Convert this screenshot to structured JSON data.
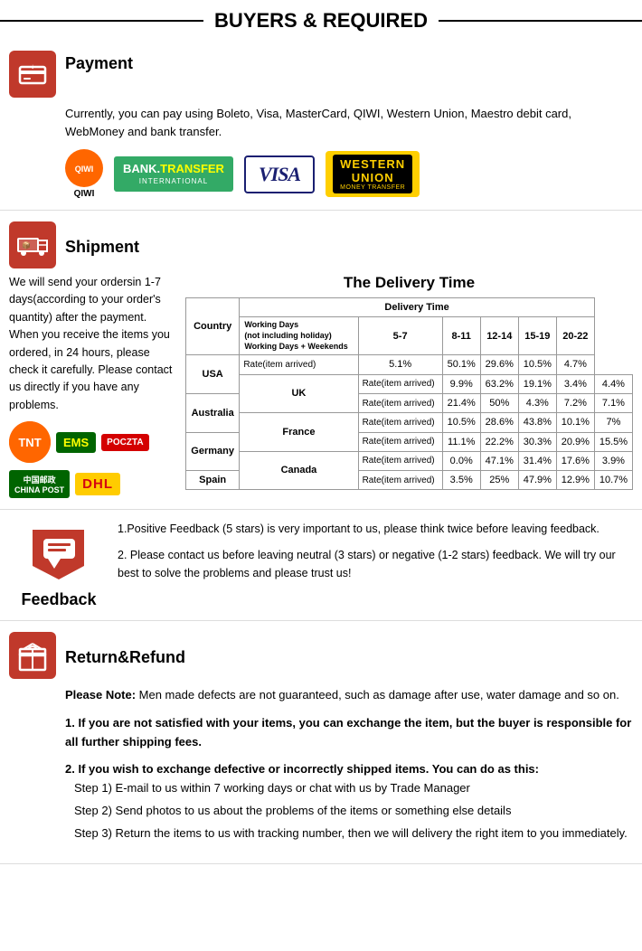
{
  "header": {
    "title": "BUYERS & REQUIRED"
  },
  "payment": {
    "section_title": "Payment",
    "description": "Currently, you can pay using Boleto, Visa, MasterCard, QIWI, Western Union, Maestro  debit card, WebMoney and bank transfer.",
    "logos": [
      {
        "name": "QIWI",
        "type": "qiwi"
      },
      {
        "name": "BANK TRANSFER INTERNATIONAL",
        "type": "bank_transfer"
      },
      {
        "name": "VISA",
        "type": "visa"
      },
      {
        "name": "WESTERN UNION MONEY TRANSFER",
        "type": "western_union"
      }
    ]
  },
  "shipment": {
    "section_title": "Shipment",
    "text": "We will send your ordersin 1-7 days(according to your order's quantity) after the payment. When you receive the items you ordered, in 24  hours, please check it carefully. Please  contact us directly if you have any problems.",
    "delivery_title": "The Delivery Time",
    "table": {
      "headers": [
        "Country",
        "Delivery Time"
      ],
      "wd_headers": [
        "Working Days\n(not including holiday)\nWorking Days + Weekends",
        "5-7",
        "8-11",
        "12-14",
        "15-19",
        "20-22"
      ],
      "rows": [
        {
          "country": "USA",
          "rate": "Rate(item arrived)",
          "cols": [
            "5.1%",
            "50.1%",
            "29.6%",
            "10.5%",
            "4.7%"
          ]
        },
        {
          "country": "UK",
          "rate": "Rate(item arrived)",
          "cols": [
            "9.9%",
            "63.2%",
            "19.1%",
            "3.4%",
            "4.4%"
          ]
        },
        {
          "country": "Australia",
          "rate": "Rate(item arrived)",
          "cols": [
            "21.4%",
            "50%",
            "4.3%",
            "7.2%",
            "7.1%"
          ]
        },
        {
          "country": "France",
          "rate": "Rate(item arrived)",
          "cols": [
            "10.5%",
            "28.6%",
            "43.8%",
            "10.1%",
            "7%"
          ]
        },
        {
          "country": "Germany",
          "rate": "Rate(item arrived)",
          "cols": [
            "11.1%",
            "22.2%",
            "30.3%",
            "20.9%",
            "15.5%"
          ]
        },
        {
          "country": "Canada",
          "rate": "Rate(item arrived)",
          "cols": [
            "0.0%",
            "47.1%",
            "31.4%",
            "17.6%",
            "3.9%"
          ]
        },
        {
          "country": "Spain",
          "rate": "Rate(item arrived)",
          "cols": [
            "3.5%",
            "25%",
            "47.9%",
            "12.9%",
            "10.7%"
          ]
        }
      ]
    }
  },
  "feedback": {
    "section_title": "Feedback",
    "point1": "1.Positive Feedback (5 stars) is very important to us, please think twice before leaving feedback.",
    "point2": "2. Please contact us before leaving neutral (3 stars) or negative  (1-2 stars) feedback. We will try our best to solve the problems and please trust us!"
  },
  "return_refund": {
    "section_title": "Return&Refund",
    "note_label": "Please Note:",
    "note_text": " Men made defects are not guaranteed, such as damage after use, water damage and so on.",
    "point1": "1. If you are not satisfied with your items, you can exchange the item, but the buyer is responsible for all further shipping fees.",
    "point2_label": "2. If you wish to exchange defective or incorrectly shipped items. You can do as this:",
    "step1": "Step 1) E-mail to us within 7 working days or chat with us by Trade Manager",
    "step2": "Step 2) Send photos to us about the problems of the items or something else details",
    "step3": "Step 3) Return the items to us with tracking number, then we will delivery the right item to you immediately."
  }
}
